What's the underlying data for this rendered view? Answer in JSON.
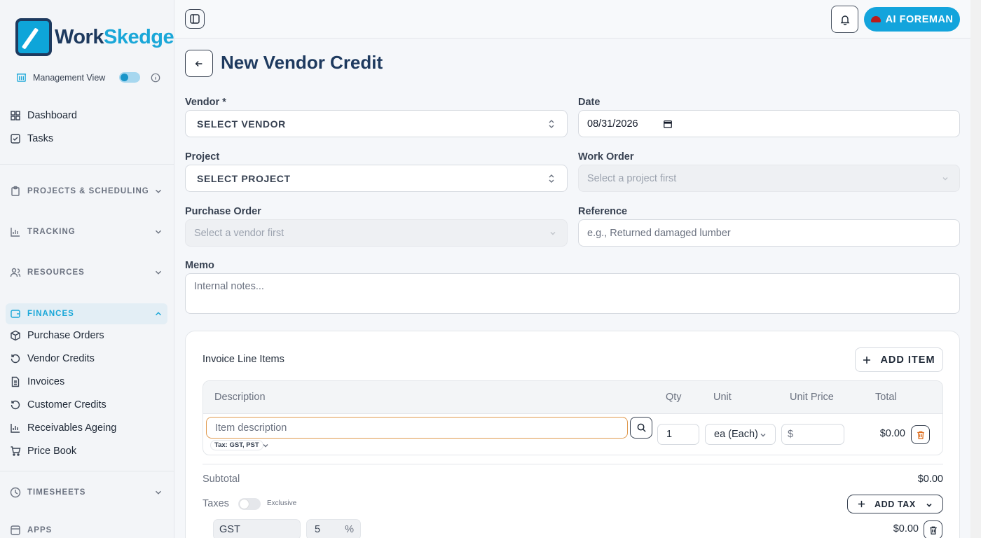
{
  "app": {
    "logo_main": "Work",
    "logo_accent": "Skedge"
  },
  "sidebar": {
    "management_view_label": "Management View",
    "top_items": [
      {
        "label": "Dashboard",
        "icon": "grid-icon"
      },
      {
        "label": "Tasks",
        "icon": "checkbox-icon"
      }
    ],
    "sections": {
      "projects": "PROJECTS & SCHEDULING",
      "tracking": "TRACKING",
      "resources": "RESOURCES",
      "finances": "FINANCES",
      "timesheets": "TIMESHEETS",
      "apps": "APPS"
    },
    "finance_items": [
      {
        "label": "Purchase Orders",
        "icon": "box-icon"
      },
      {
        "label": "Vendor Credits",
        "icon": "rotate-icon"
      },
      {
        "label": "Invoices",
        "icon": "document-icon"
      },
      {
        "label": "Customer Credits",
        "icon": "rotate-icon"
      },
      {
        "label": "Receivables Ageing",
        "icon": "bar-chart-icon"
      },
      {
        "label": "Price Book",
        "icon": "cart-icon"
      }
    ]
  },
  "topbar": {
    "ai_button_label": "AI FOREMAN"
  },
  "page": {
    "title": "New Vendor Credit"
  },
  "form": {
    "vendor_label": "Vendor *",
    "vendor_value": "SELECT VENDOR",
    "date_label": "Date",
    "date_value": "08/31/2026",
    "project_label": "Project",
    "project_value": "SELECT PROJECT",
    "work_order_label": "Work Order",
    "work_order_placeholder": "Select a project first",
    "purchase_order_label": "Purchase Order",
    "purchase_order_placeholder": "Select a vendor first",
    "reference_label": "Reference",
    "reference_placeholder": "e.g., Returned damaged lumber",
    "memo_label": "Memo",
    "memo_placeholder": "Internal notes..."
  },
  "line_items": {
    "title": "Invoice Line Items",
    "add_item_label": "ADD ITEM",
    "columns": {
      "description": "Description",
      "qty": "Qty",
      "unit": "Unit",
      "unit_price": "Unit Price",
      "total": "Total"
    },
    "row": {
      "description_placeholder": "Item description",
      "tax_badge": "Tax: GST, PST",
      "qty": "1",
      "unit": "ea (Each)",
      "price_prefix": "$",
      "total": "$0.00"
    }
  },
  "summary": {
    "subtotal_label": "Subtotal",
    "subtotal_value": "$0.00",
    "taxes_label": "Taxes",
    "exclusive_label": "Exclusive",
    "add_tax_label": "ADD TAX",
    "tax_rows": [
      {
        "name": "GST",
        "rate": "5",
        "rate_suffix": "%",
        "amount": "$0.00"
      }
    ]
  },
  "colors": {
    "accent": "#13a4dc",
    "brand_dark": "#1e3a5f"
  }
}
